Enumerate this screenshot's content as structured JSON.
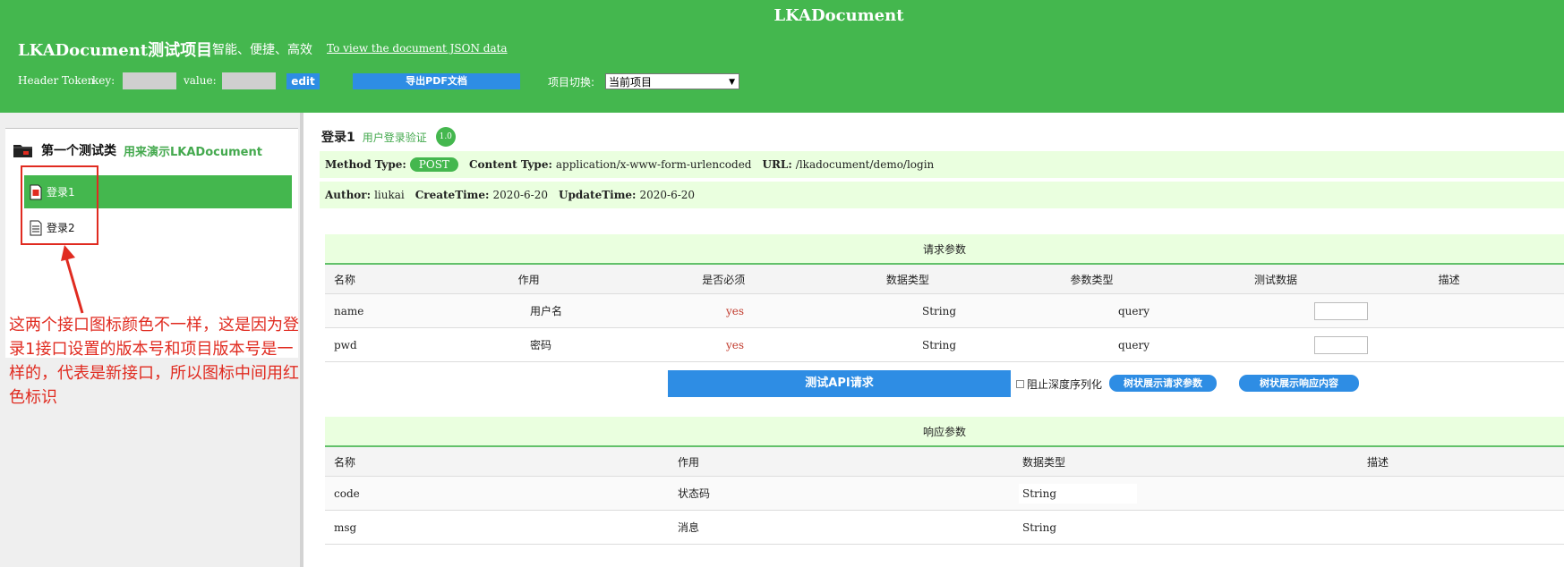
{
  "header": {
    "app_title": "LKADocument",
    "project_title": "LKADocument测试项目",
    "slogan": "智能、便捷、高效",
    "json_link": "To view the document JSON data",
    "header_token_label": "Header Token",
    "key_label": "key:",
    "value_label": "value:",
    "edit_button": "edit",
    "export_pdf_button": "导出PDF文档",
    "project_switch_label": "项目切换:",
    "project_select_value": "当前项目",
    "accent_color": "#44b74e",
    "button_color": "#2e8de4"
  },
  "sidebar": {
    "category_name": "第一个测试类",
    "category_desc": "用来演示LKADocument",
    "items": [
      {
        "label": "登录1",
        "active": true,
        "icon": "file-icon-new"
      },
      {
        "label": "登录2",
        "active": false,
        "icon": "file-icon"
      }
    ],
    "annotation": "这两个接口图标颜色不一样，这是因为登录1接口设置的版本号和项目版本号是一样的，代表是新接口，所以图标中间用红色标识"
  },
  "api": {
    "title": "登录1",
    "subtitle": "用户登录验证",
    "version": "1.0",
    "method_type_label": "Method Type:",
    "method": "POST",
    "content_type_label": "Content Type:",
    "content_type": "application/x-www-form-urlencoded",
    "url_label": "URL:",
    "url": "/lkadocument/demo/login",
    "author_label": "Author:",
    "author": "liukai",
    "create_time_label": "CreateTime:",
    "create_time": "2020-6-20",
    "update_time_label": "UpdateTime:",
    "update_time": "2020-6-20"
  },
  "request_params": {
    "title": "请求参数",
    "columns": [
      "名称",
      "作用",
      "是否必须",
      "数据类型",
      "参数类型",
      "测试数据",
      "描述"
    ],
    "rows": [
      {
        "name": "name",
        "purpose": "用户名",
        "required": "yes",
        "data_type": "String",
        "param_type": "query"
      },
      {
        "name": "pwd",
        "purpose": "密码",
        "required": "yes",
        "data_type": "String",
        "param_type": "query"
      }
    ]
  },
  "actions": {
    "test_button": "测试API请求",
    "prevent_deep_serialize": "阻止深度序列化",
    "tree_request_button": "树状展示请求参数",
    "tree_response_button": "树状展示响应内容"
  },
  "response_params": {
    "title": "响应参数",
    "columns": [
      "名称",
      "作用",
      "数据类型",
      "描述"
    ],
    "rows": [
      {
        "name": "code",
        "purpose": "状态码",
        "data_type": "String"
      },
      {
        "name": "msg",
        "purpose": "消息",
        "data_type": "String"
      }
    ]
  }
}
